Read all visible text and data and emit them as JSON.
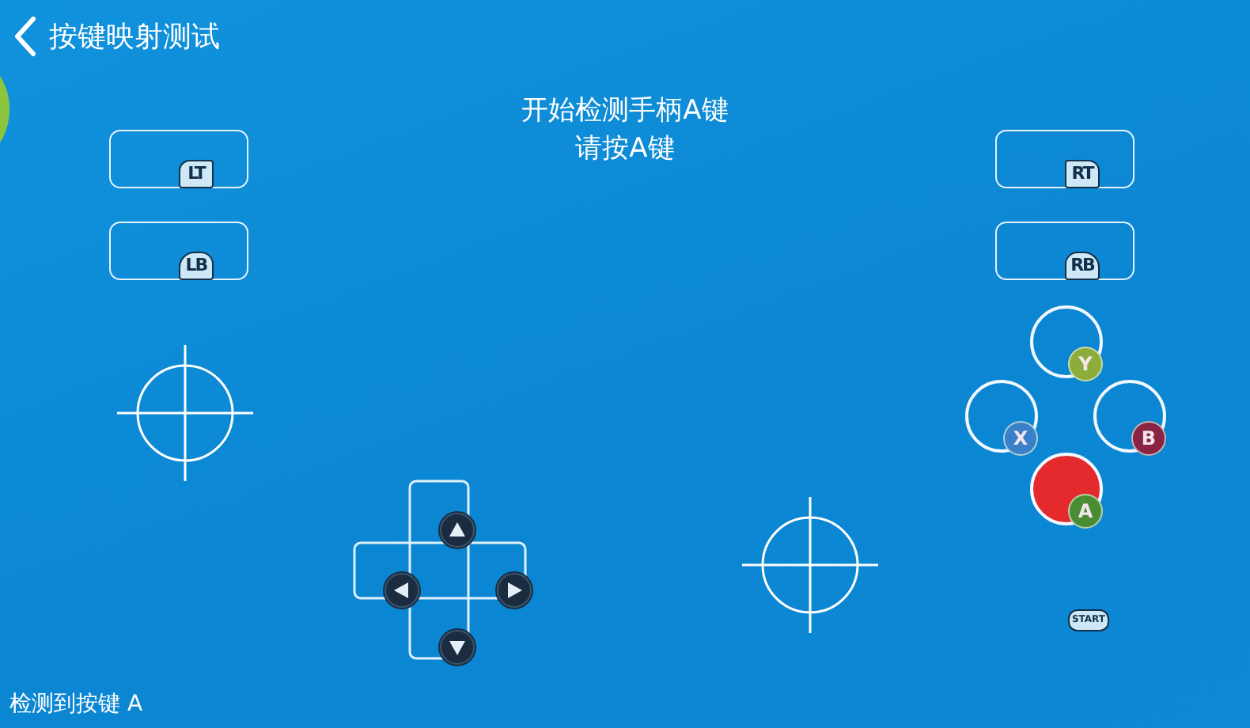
{
  "header": {
    "title": "按键映射测试"
  },
  "prompt": {
    "lines": [
      "开始检测手柄A键",
      "请按A键"
    ]
  },
  "shoulder_buttons": [
    {
      "label": "LT"
    },
    {
      "label": "LB"
    },
    {
      "label": "RT"
    },
    {
      "label": "RB"
    }
  ],
  "face_buttons": [
    {
      "label": "Y",
      "color": "#8cac3c",
      "pressed": false
    },
    {
      "label": "X",
      "color": "#3a80c8",
      "pressed": false
    },
    {
      "label": "B",
      "color": "#8a2444",
      "pressed": false
    },
    {
      "label": "A",
      "color": "#4a8c34",
      "pressed": true
    }
  ],
  "start_button": {
    "label": "START"
  },
  "status_bar": {
    "text": "检测到按键 A"
  }
}
